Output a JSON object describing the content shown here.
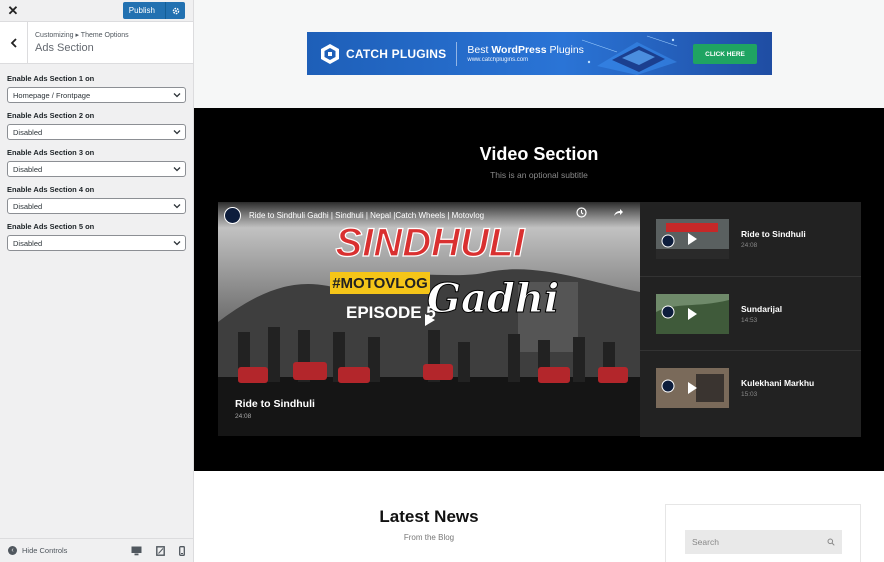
{
  "customizer": {
    "close_glyph": "✕",
    "publish_label": "Publish",
    "breadcrumb": "Customizing ▸ Theme Options",
    "section_title": "Ads Section",
    "controls": [
      {
        "label": "Enable Ads Section 1 on",
        "value": "Homepage / Frontpage"
      },
      {
        "label": "Enable Ads Section 2 on",
        "value": "Disabled"
      },
      {
        "label": "Enable Ads Section 3 on",
        "value": "Disabled"
      },
      {
        "label": "Enable Ads Section 4 on",
        "value": "Disabled"
      },
      {
        "label": "Enable Ads Section 5 on",
        "value": "Disabled"
      }
    ],
    "hide_controls_label": "Hide Controls",
    "devices": [
      "desktop-icon",
      "tablet-icon",
      "mobile-icon"
    ]
  },
  "ad_banner": {
    "brand": "CATCH PLUGINS",
    "tagline_prefix": "Best ",
    "tagline_bold": "WordPress",
    "tagline_suffix": " Plugins",
    "url": "www.catchplugins.com",
    "cta": "CLICK HERE"
  },
  "video_section": {
    "title": "Video Section",
    "subtitle": "This is an optional subtitle",
    "player": {
      "video_title": "Ride to Sindhuli Gadhi | Sindhuli | Nepal |Catch Wheels | Motovlog",
      "art_heading": "SINDHULI",
      "art_hashtag": "#MOTOVLOG",
      "art_script": "Gadhi",
      "art_episode": "EPISODE 5",
      "overlay_title": "Ride to Sindhuli",
      "overlay_duration": "24:08"
    },
    "playlist": [
      {
        "title": "Ride to Sindhuli",
        "duration": "24:08"
      },
      {
        "title": "Sundarijal",
        "duration": "14:53"
      },
      {
        "title": "Kulekhani Markhu",
        "duration": "15:03"
      }
    ]
  },
  "news": {
    "title": "Latest News",
    "subtitle": "From the Blog",
    "search_placeholder": "Search"
  },
  "colors": {
    "accent": "#2271b1",
    "banner_blue": "#2a74d6",
    "cta_green": "#1fa462",
    "video_bg": "#000000"
  }
}
